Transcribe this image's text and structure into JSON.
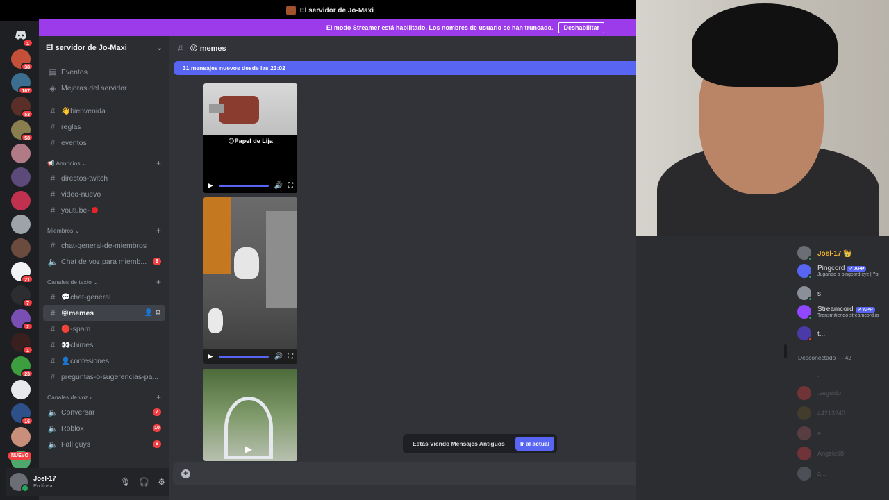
{
  "window": {
    "title": "El servidor de Jo-Maxi"
  },
  "streamer_bar": {
    "message": "El modo Streamer está habilitado. Los nombres de usuario se han truncado.",
    "button": "Deshabilitar"
  },
  "rail": {
    "badges": [
      "1",
      "38",
      "167",
      "53",
      "58",
      "",
      "",
      "",
      "",
      "",
      "21",
      "7",
      "2",
      "1",
      "23",
      "",
      "16",
      "",
      ""
    ],
    "nuevo": "NUEVO"
  },
  "sidebar": {
    "server_name": "El servidor de Jo-Maxi",
    "top_items": [
      {
        "label": "Eventos",
        "icon": "calendar-icon"
      },
      {
        "label": "Mejoras del servidor",
        "icon": "boost-icon"
      }
    ],
    "channels_a": [
      "👋bienvenida",
      "reglas",
      "eventos"
    ],
    "cat_anuncios": "📢 Anuncios",
    "channels_b": [
      "directos-twitch",
      "video-nuevo",
      "youtube-"
    ],
    "cat_miembros": "Miembros",
    "channels_c": [
      {
        "label": "chat-general-de-miembros",
        "icon": "#"
      },
      {
        "label": "Chat de voz para miemb...",
        "icon": "🔊",
        "count": "9"
      }
    ],
    "cat_texto": "Canales de texto",
    "channels_d": [
      "💬chat-general",
      "😝memes",
      "🔴-spam",
      "👀chimes",
      "👤confesiones",
      "preguntas-o-sugerencias-pa..."
    ],
    "cat_voz": "Canales de voz",
    "voice_channels": [
      {
        "label": "Conversar",
        "count": "7"
      },
      {
        "label": "Roblox",
        "count": "10"
      },
      {
        "label": "Fall guys",
        "count": "9"
      }
    ]
  },
  "user": {
    "name": "Joel-17",
    "status": "En línea"
  },
  "chat": {
    "channel": "😝 memes",
    "new_messages": "31 mensajes nuevos desde las 23:02",
    "meme_caption": "😊Papel de Lija",
    "old_messages": "Estás Viendo Mensajes Antiguos",
    "jump_button": "Ir al actual"
  },
  "members": {
    "online": [
      {
        "name": "Joel-17 👑",
        "activity": "",
        "gold": true,
        "color": "#6b6e74"
      },
      {
        "name": "Pingcord",
        "app": "✔ APP",
        "activity": "Jugando a pingcord.xyz | ?pi",
        "color": "#5865f2"
      },
      {
        "name": "s",
        "activity": "",
        "color": "#8a8f98"
      },
      {
        "name": "Streamcord",
        "app": "✔ APP",
        "activity": "Transmitiendo streamcord.io",
        "color": "#9146ff"
      },
      {
        "name": "t...",
        "activity": "",
        "color": "#4a3aa8"
      }
    ],
    "offline_header": "Desconectado — 42",
    "offline": [
      ".",
      ".seguido",
      "44213240",
      "a...",
      "Angelo98",
      "a..."
    ]
  },
  "colors": {
    "accent": "#5865f2",
    "streamer": "#9c3bea",
    "danger": "#f23f43"
  }
}
